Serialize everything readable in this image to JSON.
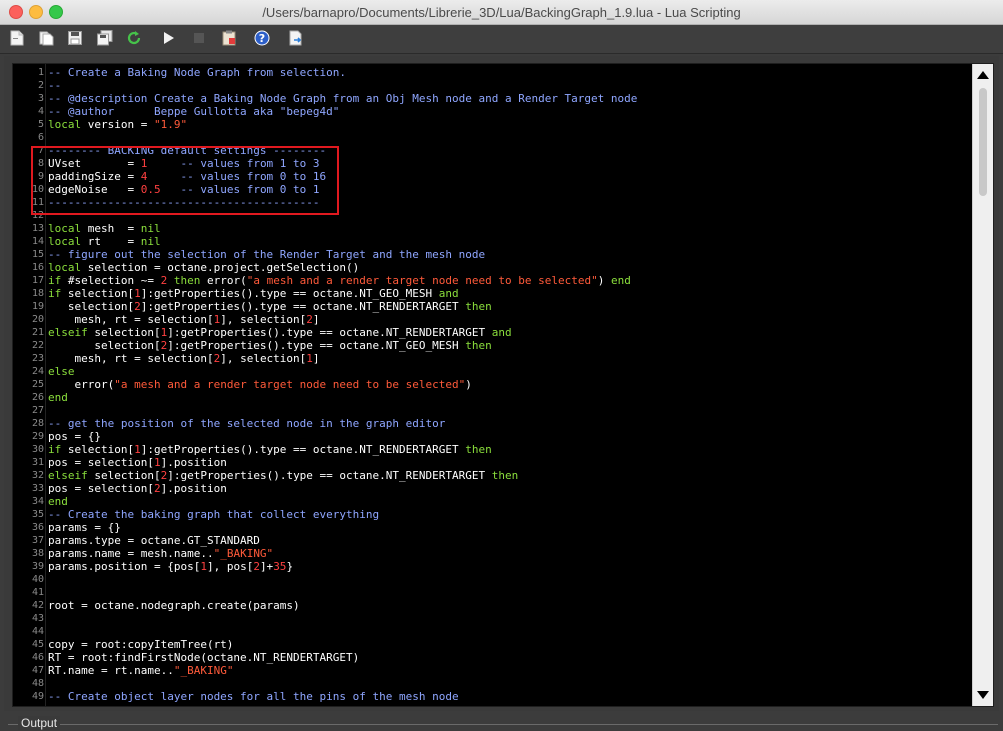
{
  "window": {
    "title": "/Users/barnapro/Documents/Librerie_3D/Lua/BackingGraph_1.9.lua - Lua Scripting"
  },
  "toolbar": {
    "buttons": [
      {
        "icon": "new-file-icon"
      },
      {
        "icon": "open-file-icon"
      },
      {
        "icon": "save-icon"
      },
      {
        "icon": "save-all-icon"
      },
      {
        "icon": "reload-icon"
      },
      {
        "icon": "run-icon"
      },
      {
        "icon": "stop-icon"
      },
      {
        "icon": "clipboard-icon"
      },
      {
        "icon": "help-icon"
      },
      {
        "icon": "export-icon"
      }
    ]
  },
  "output": {
    "label": "Output"
  },
  "colors": {
    "comment": "#8fa6ff",
    "keyword": "#8bdf3c",
    "string": "#ff5a3a",
    "number": "#ff4040",
    "highlight_box": "#e0191f"
  },
  "editor": {
    "lines": [
      {
        "num": "1",
        "text": "-- Create a Baking Node Graph from selection."
      },
      {
        "num": "2",
        "text": "--"
      },
      {
        "num": "3",
        "text": "-- @description Create a Baking Node Graph from an Obj Mesh node and a Render Target node"
      },
      {
        "num": "4",
        "text": "-- @author      Beppe Gullotta aka \"bepeg4d\""
      },
      {
        "num": "5",
        "text": "local version = \"1.9\""
      },
      {
        "num": "6",
        "text": ""
      },
      {
        "num": "7",
        "text": "-------- BACKING default settings --------"
      },
      {
        "num": "8",
        "text": "UVset       = 1     -- values from 1 to 3"
      },
      {
        "num": "9",
        "text": "paddingSize = 4     -- values from 0 to 16"
      },
      {
        "num": "10",
        "text": "edgeNoise   = 0.5   -- values from 0 to 1"
      },
      {
        "num": "11",
        "text": "-----------------------------------------"
      },
      {
        "num": "12",
        "text": ""
      },
      {
        "num": "13",
        "text": "local mesh  = nil"
      },
      {
        "num": "14",
        "text": "local rt    = nil"
      },
      {
        "num": "15",
        "text": "-- figure out the selection of the Render Target and the mesh node"
      },
      {
        "num": "16",
        "text": "local selection = octane.project.getSelection()"
      },
      {
        "num": "17",
        "text": "if #selection ~= 2 then error(\"a mesh and a render target node need to be selected\") end"
      },
      {
        "num": "18",
        "text": "if selection[1]:getProperties().type == octane.NT_GEO_MESH and"
      },
      {
        "num": "19",
        "text": "   selection[2]:getProperties().type == octane.NT_RENDERTARGET then"
      },
      {
        "num": "20",
        "text": "    mesh, rt = selection[1], selection[2]"
      },
      {
        "num": "21",
        "text": "elseif selection[1]:getProperties().type == octane.NT_RENDERTARGET and"
      },
      {
        "num": "22",
        "text": "       selection[2]:getProperties().type == octane.NT_GEO_MESH then"
      },
      {
        "num": "23",
        "text": "    mesh, rt = selection[2], selection[1]"
      },
      {
        "num": "24",
        "text": "else"
      },
      {
        "num": "25",
        "text": "    error(\"a mesh and a render target node need to be selected\")"
      },
      {
        "num": "26",
        "text": "end"
      },
      {
        "num": "27",
        "text": ""
      },
      {
        "num": "28",
        "text": "-- get the position of the selected node in the graph editor"
      },
      {
        "num": "29",
        "text": "pos = {}"
      },
      {
        "num": "30",
        "text": "if selection[1]:getProperties().type == octane.NT_RENDERTARGET then"
      },
      {
        "num": "31",
        "text": "pos = selection[1].position"
      },
      {
        "num": "32",
        "text": "elseif selection[2]:getProperties().type == octane.NT_RENDERTARGET then"
      },
      {
        "num": "33",
        "text": "pos = selection[2].position"
      },
      {
        "num": "34",
        "text": "end"
      },
      {
        "num": "35",
        "text": "-- Create the baking graph that collect everything"
      },
      {
        "num": "36",
        "text": "params = {}"
      },
      {
        "num": "37",
        "text": "params.type = octane.GT_STANDARD"
      },
      {
        "num": "38",
        "text": "params.name = mesh.name..\"_BAKING\""
      },
      {
        "num": "39",
        "text": "params.position = {pos[1], pos[2]+35}"
      },
      {
        "num": "40",
        "text": ""
      },
      {
        "num": "41",
        "text": ""
      },
      {
        "num": "42",
        "text": "root = octane.nodegraph.create(params)"
      },
      {
        "num": "43",
        "text": ""
      },
      {
        "num": "44",
        "text": ""
      },
      {
        "num": "45",
        "text": "copy = root:copyItemTree(rt)"
      },
      {
        "num": "46",
        "text": "RT = root:findFirstNode(octane.NT_RENDERTARGET)"
      },
      {
        "num": "47",
        "text": "RT.name = rt.name..\"_BAKING\""
      },
      {
        "num": "48",
        "text": ""
      },
      {
        "num": "49",
        "text": "-- Create object layer nodes for all the pins of the mesh node"
      }
    ]
  }
}
